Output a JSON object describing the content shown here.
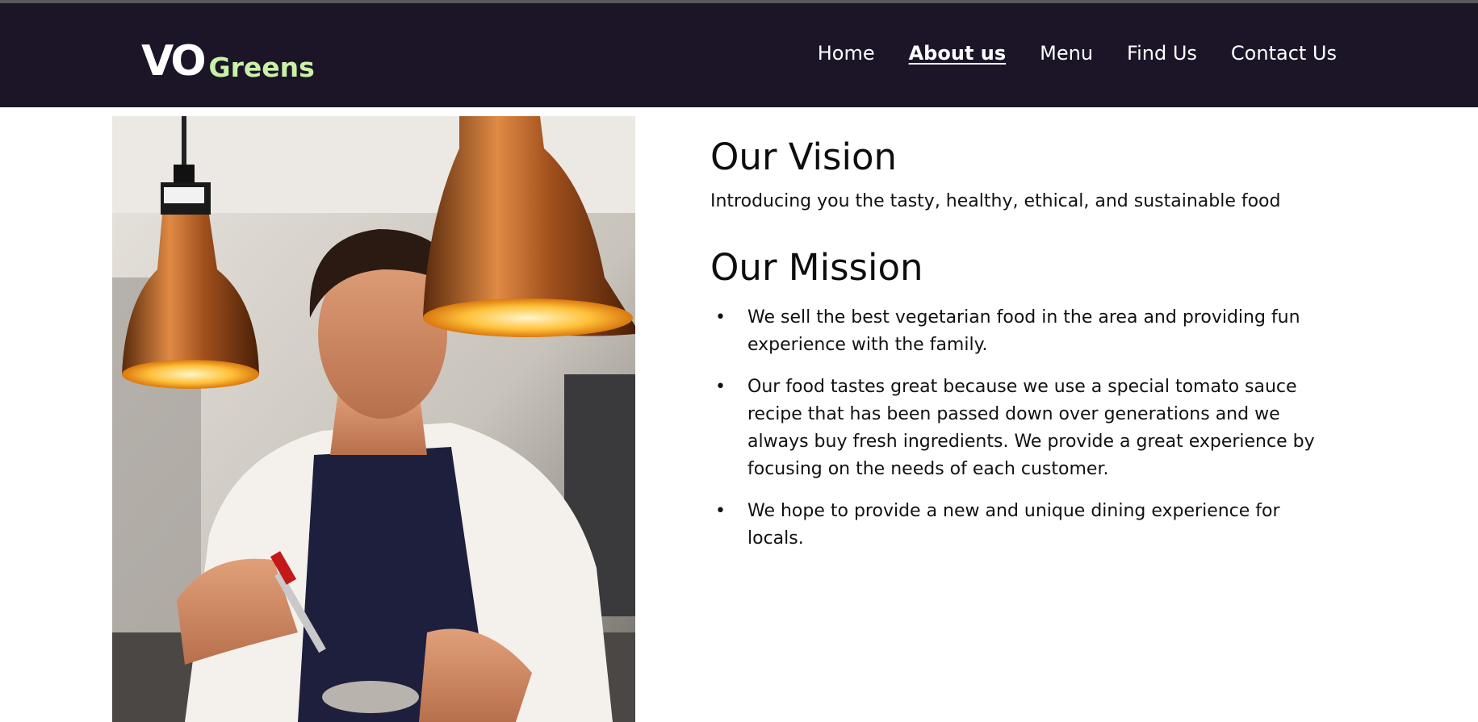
{
  "header": {
    "logo": {
      "part1": "VO",
      "part2": "Greens"
    },
    "nav": [
      {
        "label": "Home",
        "active": false
      },
      {
        "label": "About us",
        "active": true
      },
      {
        "label": "Menu",
        "active": false
      },
      {
        "label": "Find Us",
        "active": false
      },
      {
        "label": "Contact Us",
        "active": false
      }
    ]
  },
  "main": {
    "vision": {
      "title": "Our Vision",
      "text": "Introducing you the tasty, healthy, ethical, and sustainable food"
    },
    "mission": {
      "title": "Our Mission",
      "items": [
        "We sell the best vegetarian food in the area and providing fun experience with the family.",
        "Our food tastes great because we use a special tomato sauce recipe that has been passed down over generations and we always buy fresh ingredients. We provide a great experience by focusing on the needs of each customer.",
        "We hope to provide a new and unique dining experience for locals."
      ]
    }
  },
  "colors": {
    "navbar_bg": "#1c1528",
    "logo_accent": "#c9f2a8",
    "text": "#111111",
    "background": "#ffffff"
  }
}
